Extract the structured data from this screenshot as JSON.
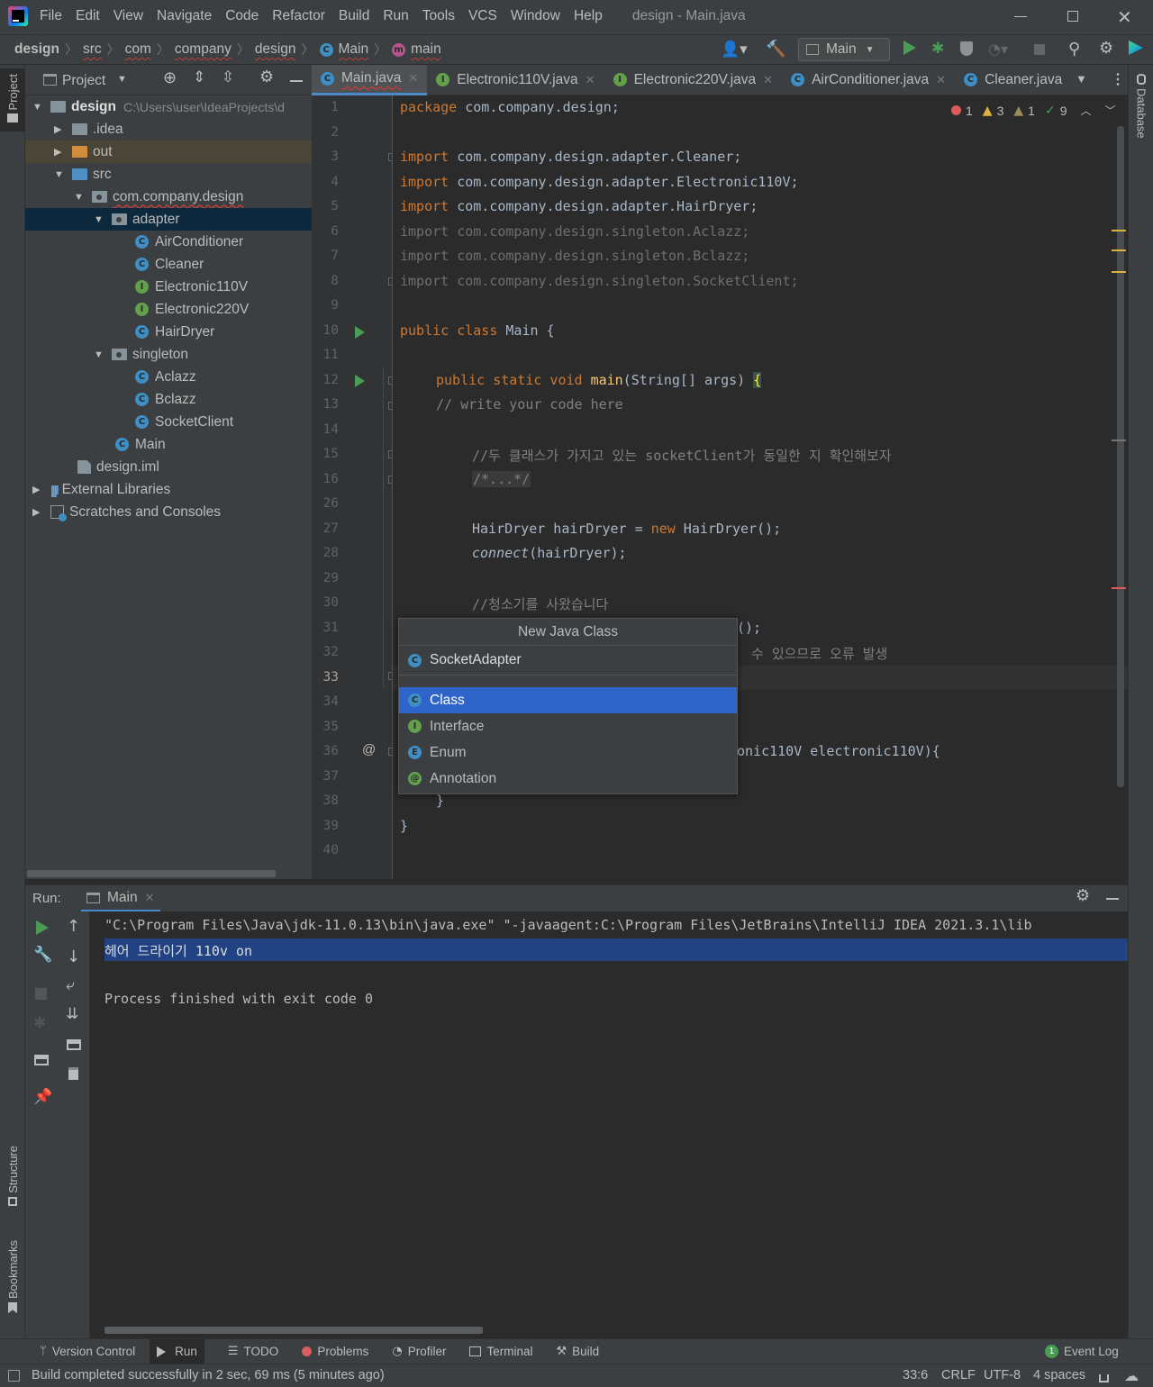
{
  "window": {
    "title": "design - Main.java"
  },
  "menu": [
    "File",
    "Edit",
    "View",
    "Navigate",
    "Code",
    "Refactor",
    "Build",
    "Run",
    "Tools",
    "VCS",
    "Window",
    "Help"
  ],
  "breadcrumbs": [
    "design",
    "src",
    "com",
    "company",
    "design",
    "Main",
    "main"
  ],
  "run_config": "Main",
  "project_panel": {
    "title": "Project",
    "root_name": "design",
    "root_path": "C:\\Users\\user\\IdeaProjects\\d",
    "nodes": [
      ".idea",
      "out",
      "src",
      "com.company.design",
      "adapter",
      "AirConditioner",
      "Cleaner",
      "Electronic110V",
      "Electronic220V",
      "HairDryer",
      "singleton",
      "Aclazz",
      "Bclazz",
      "SocketClient",
      "Main",
      "design.iml",
      "External Libraries",
      "Scratches and Consoles"
    ]
  },
  "tabs": [
    "Main.java",
    "Electronic110V.java",
    "Electronic220V.java",
    "AirConditioner.java",
    "Cleaner.java"
  ],
  "inspections": {
    "errors": "1",
    "warnings": "3",
    "weak_warnings": "1",
    "typos": "9"
  },
  "code": {
    "line_numbers": [
      "1",
      "2",
      "3",
      "4",
      "5",
      "6",
      "7",
      "8",
      "9",
      "10",
      "11",
      "12",
      "13",
      "14",
      "15",
      "16",
      "26",
      "27",
      "28",
      "29",
      "30",
      "31",
      "32",
      "33",
      "34",
      "35",
      "36",
      "37",
      "38",
      "39",
      "40"
    ],
    "l1_kw": "package",
    "l1_rest": " com.company.design;",
    "l3_kw": "import",
    "l3_rest": " com.company.design.adapter.Cleaner;",
    "l4_kw": "import",
    "l4_rest": " com.company.design.adapter.Electronic110V;",
    "l5_kw": "import",
    "l5_rest": " com.company.design.adapter.HairDryer;",
    "l6": "import com.company.design.singleton.Aclazz;",
    "l7": "import com.company.design.singleton.Bclazz;",
    "l8": "import com.company.design.singleton.SocketClient;",
    "l10_kw": "public class",
    "l10_rest": " Main {",
    "l12_kw": "public static void",
    "l12_fn": " main",
    "l12_rest": "(String[] args) ",
    "l12_brace": "{",
    "l13": "// write your code here",
    "l15": "//두 클래스가 가지고 있는 socketClient가 동일한 지 확인해보자",
    "l16": "/*...*/",
    "l27_a": "HairDryer hairDryer = ",
    "l27_kw": "new",
    "l27_b": " HairDryer();",
    "l28_fn": "connect",
    "l28_rest": "(hairDryer);",
    "l30": "//청소기를 사왔습니다",
    "l31": "();",
    "l32": "수 있으므로 오류 발생",
    "l36": "onic110V electronic110V){",
    "l38": "}",
    "l39": "}"
  },
  "popup": {
    "title": "New Java Class",
    "input_value": "SocketAdapter",
    "options": [
      "Class",
      "Interface",
      "Enum",
      "Annotation"
    ],
    "selected": "Class"
  },
  "run_panel": {
    "label": "Run:",
    "tab": "Main",
    "lines": [
      "\"C:\\Program Files\\Java\\jdk-11.0.13\\bin\\java.exe\" \"-javaagent:C:\\Program Files\\JetBrains\\IntelliJ IDEA 2021.3.1\\lib",
      "헤어 드라이기 110v on",
      "",
      "Process finished with exit code 0"
    ]
  },
  "side_tabs": {
    "project": "Project",
    "structure": "Structure",
    "bookmarks": "Bookmarks",
    "database": "Database"
  },
  "bottom_tools": [
    "Version Control",
    "Run",
    "TODO",
    "Problems",
    "Profiler",
    "Terminal",
    "Build"
  ],
  "event_log": {
    "count": "1",
    "label": "Event Log"
  },
  "status": {
    "message": "Build completed successfully in 2 sec, 69 ms (5 minutes ago)",
    "position": "33:6",
    "line_sep": "CRLF",
    "encoding": "UTF-8",
    "indent": "4 spaces"
  },
  "colors": {
    "accent": "#2f65ca",
    "error": "#db5c5c",
    "warning": "#e0b03d",
    "run": "#499c54"
  }
}
